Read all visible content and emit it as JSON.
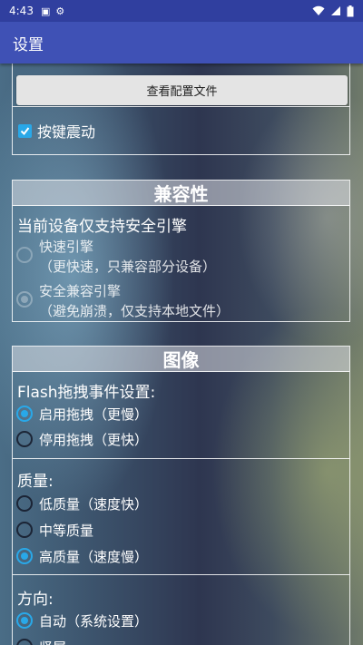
{
  "status_bar": {
    "time": "4:43"
  },
  "app_bar": {
    "title": "设置"
  },
  "general": {
    "config_button_label": "查看配置文件",
    "vibration_label": "按键震动",
    "vibration_checked": true
  },
  "compatibility": {
    "title": "兼容性",
    "notice": "当前设备仅支持安全引擎",
    "options": [
      {
        "label": "快速引擎",
        "sublabel": "（更快速，只兼容部分设备）",
        "selected": false,
        "enabled": false
      },
      {
        "label": "安全兼容引擎",
        "sublabel": "（避免崩溃，仅支持本地文件）",
        "selected": true,
        "enabled": false
      }
    ]
  },
  "image": {
    "title": "图像",
    "drag": {
      "label": "Flash拖拽事件设置:",
      "options": [
        {
          "label": "启用拖拽（更慢）",
          "selected": true
        },
        {
          "label": "停用拖拽（更快）",
          "selected": false
        }
      ]
    },
    "quality": {
      "label": "质量:",
      "options": [
        {
          "label": "低质量（速度快）",
          "selected": false
        },
        {
          "label": "中等质量",
          "selected": false
        },
        {
          "label": "高质量（速度慢）",
          "selected": true
        }
      ]
    },
    "orientation": {
      "label": "方向:",
      "options": [
        {
          "label": "自动（系统设置）",
          "selected": true
        },
        {
          "label": "竖屏",
          "selected": false
        }
      ]
    }
  },
  "colors": {
    "app_bar": "#3f51b5",
    "status_bar": "#303f9f",
    "accent": "#29a8e8"
  }
}
